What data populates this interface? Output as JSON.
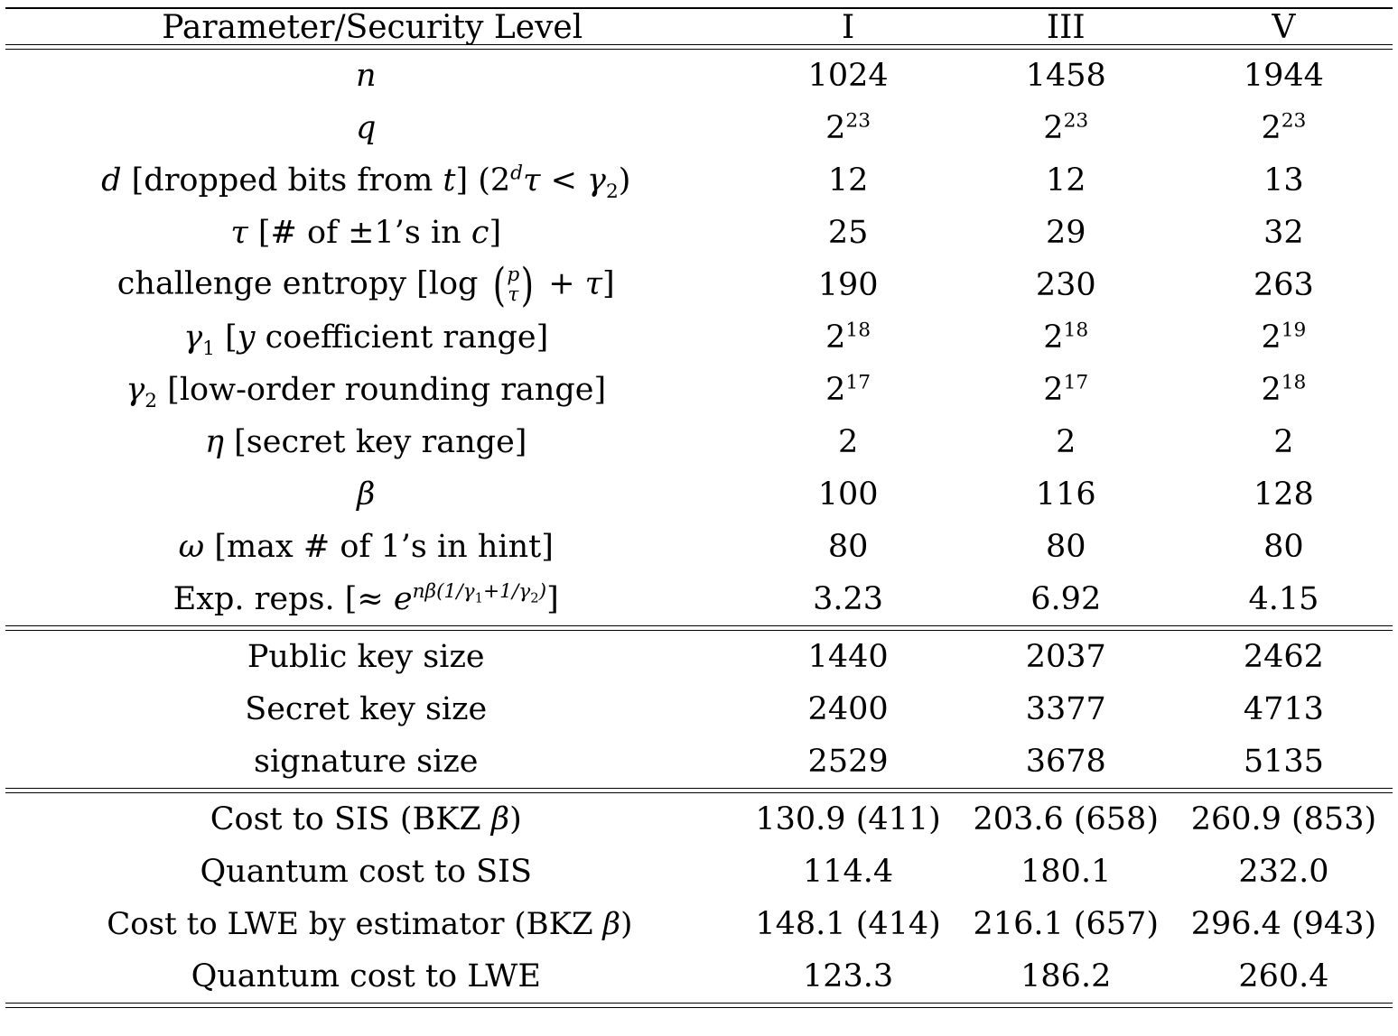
{
  "table": {
    "caption_header": "Parameter/Security Level",
    "levels": [
      "I",
      "III",
      "V"
    ],
    "sections": [
      {
        "name": "parameters",
        "rows": [
          {
            "label_plain": "n",
            "label_html": "<span class=\"mi\">n</span>",
            "values": [
              "1024",
              "1458",
              "1944"
            ]
          },
          {
            "label_plain": "q",
            "label_html": "<span class=\"mi\">q</span>",
            "values": [
              "2^23",
              "2^23",
              "2^23"
            ],
            "values_html": [
              "2<sup class=\"exp\">23</sup>",
              "2<sup class=\"exp\">23</sup>",
              "2<sup class=\"exp\">23</sup>"
            ]
          },
          {
            "label_plain": "d [dropped bits from t] (2^d τ < γ₂)",
            "label_html": "<span class=\"mi\">d</span> [dropped bits from <span class=\"mi\">t</span>] (2<span class=\"sup-nested\">d</span><span class=\"mgreek\">τ</span> &lt; <span class=\"mgreek\">γ</span><sub class=\"sb\">2</sub>)",
            "values": [
              "12",
              "12",
              "13"
            ]
          },
          {
            "label_plain": "τ [# of ±1's in c]",
            "label_html": "<span class=\"mgreek\">τ</span> [# of ±1’s in <span class=\"mi\">c</span>]",
            "values": [
              "25",
              "29",
              "32"
            ]
          },
          {
            "label_plain": "challenge entropy [log (p τ) + τ]",
            "label_html": "challenge entropy [log <span class=\"binom\"><span class=\"paren\">(</span><span class=\"stack\"><span>p</span><span>τ</span></span><span class=\"paren\">)</span></span> + <span class=\"mgreek\">τ</span>]",
            "values": [
              "190",
              "230",
              "263"
            ]
          },
          {
            "label_plain": "γ₁ [y coefficient range]",
            "label_html": "<span class=\"mgreek\">γ</span><sub class=\"sb\">1</sub> [<span class=\"mi\">y</span> coefficient range]",
            "values": [
              "2^18",
              "2^18",
              "2^19"
            ],
            "values_html": [
              "2<sup class=\"exp\">18</sup>",
              "2<sup class=\"exp\">18</sup>",
              "2<sup class=\"exp\">19</sup>"
            ]
          },
          {
            "label_plain": "γ₂ [low-order rounding range]",
            "label_html": "<span class=\"mgreek\">γ</span><sub class=\"sb\">2</sub> [low-order rounding range]",
            "values": [
              "2^17",
              "2^17",
              "2^18"
            ],
            "values_html": [
              "2<sup class=\"exp\">17</sup>",
              "2<sup class=\"exp\">17</sup>",
              "2<sup class=\"exp\">18</sup>"
            ]
          },
          {
            "label_plain": "η [secret key range]",
            "label_html": "<span class=\"mgreek\">η</span> [secret key range]",
            "values": [
              "2",
              "2",
              "2"
            ]
          },
          {
            "label_plain": "β",
            "label_html": "<span class=\"mgreek\">β</span>",
            "values": [
              "100",
              "116",
              "128"
            ]
          },
          {
            "label_plain": "ω [max # of 1's in hint]",
            "label_html": "<span class=\"mgreek\">ω</span> [max # of 1’s in hint]",
            "values": [
              "80",
              "80",
              "80"
            ]
          },
          {
            "label_plain": "Exp. reps. [≈ e^{nβ(1/γ₁+1/γ₂)}]",
            "label_html": "Exp. reps. [≈ <span class=\"mi\">e</span><span class=\"sup-nested\">nβ(1/γ<sub>1</sub>+1/γ<sub>2</sub>)</span>]",
            "values": [
              "3.23",
              "6.92",
              "4.15"
            ]
          }
        ]
      },
      {
        "name": "sizes",
        "rows": [
          {
            "label_plain": "Public key size",
            "label_html": "Public key size",
            "values": [
              "1440",
              "2037",
              "2462"
            ]
          },
          {
            "label_plain": "Secret key size",
            "label_html": "Secret key size",
            "values": [
              "2400",
              "3377",
              "4713"
            ]
          },
          {
            "label_plain": "signature size",
            "label_html": "signature size",
            "values": [
              "2529",
              "3678",
              "5135"
            ]
          }
        ]
      },
      {
        "name": "security-costs",
        "rows": [
          {
            "label_plain": "Cost to SIS (BKZ β)",
            "label_html": "Cost to SIS (BKZ <span class=\"mgreek\">β</span>)",
            "values": [
              "130.9 (411)",
              "203.6 (658)",
              "260.9 (853)"
            ]
          },
          {
            "label_plain": "Quantum cost to SIS",
            "label_html": "Quantum cost to SIS",
            "values": [
              "114.4",
              "180.1",
              "232.0"
            ]
          },
          {
            "label_plain": "Cost to LWE by estimator (BKZ β)",
            "label_html": "Cost to LWE by estimator (BKZ <span class=\"mgreek\">β</span>)",
            "wide": true,
            "values": [
              "148.1 (414)",
              "216.1 (657)",
              "296.4 (943)"
            ]
          },
          {
            "label_plain": "Quantum cost to LWE",
            "label_html": "Quantum cost to LWE",
            "values": [
              "123.3",
              "186.2",
              "260.4"
            ]
          }
        ]
      }
    ]
  }
}
